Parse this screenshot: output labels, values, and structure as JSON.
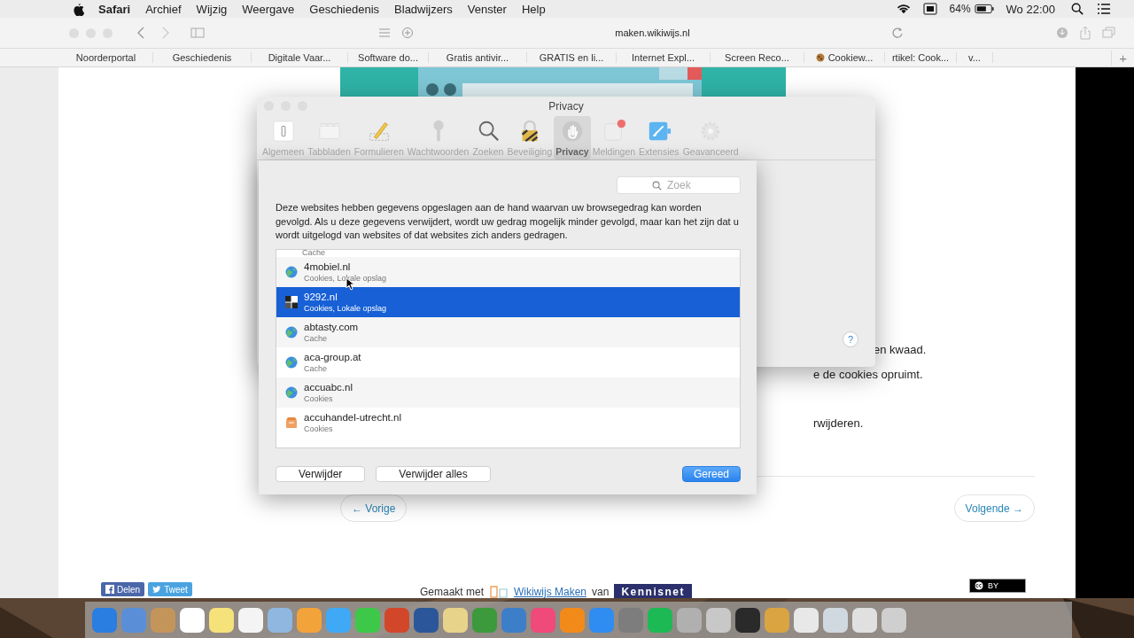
{
  "menu_bar": {
    "app": "Safari",
    "menus": [
      "Archief",
      "Wijzig",
      "Weergave",
      "Geschiedenis",
      "Bladwijzers",
      "Venster",
      "Help"
    ],
    "battery": "64%",
    "clock": "Wo 22:00"
  },
  "browser": {
    "url": "maken.wikiwijs.nl",
    "bookmarks": [
      "Noorderportal",
      "Geschiedenis",
      "Digitale Vaar...",
      "Software do...",
      "Gratis antivir...",
      "GRATIS en li...",
      "Internet Expl...",
      "Screen Reco...",
      "Cookiew...",
      "rtikel: Cook...",
      "v..."
    ],
    "new_tab": "+"
  },
  "page": {
    "texts": [
      "en kwaad.",
      "e de cookies opruimt.",
      "rwijderen."
    ],
    "previous": "← Vorige",
    "next": "Volgende →",
    "share": [
      "Delen",
      "Tweet"
    ],
    "footer": {
      "made_with": "Gemaakt met",
      "link": "Wikiwijs Maken",
      "by": "van",
      "brand": "Kennisnet",
      "license": "BY"
    }
  },
  "prefs_window": {
    "title": "Privacy",
    "tabs": [
      {
        "label": "Algemeen",
        "selected": false
      },
      {
        "label": "Tabbladen",
        "selected": false
      },
      {
        "label": "Formulieren",
        "selected": false
      },
      {
        "label": "Wachtwoorden",
        "selected": false
      },
      {
        "label": "Zoeken",
        "selected": false
      },
      {
        "label": "Beveiliging",
        "selected": false
      },
      {
        "label": "Privacy",
        "selected": true
      },
      {
        "label": "Meldingen",
        "selected": false
      },
      {
        "label": "Extensies",
        "selected": false
      },
      {
        "label": "Geavanceerd",
        "selected": false
      }
    ],
    "help": "?"
  },
  "sheet": {
    "search": {
      "placeholder": "Zoek"
    },
    "description": "Deze websites hebben gegevens opgeslagen aan de hand waarvan uw browsegedrag kan worden gevolgd. Als u deze gegevens verwijdert, wordt uw gedrag mogelijk minder gevolgd, maar kan het zijn dat u wordt uitgelogd van websites of dat websites zich anders gedragen.",
    "sites": [
      {
        "kind": "partial",
        "detail": "Cache",
        "selected": false
      },
      {
        "kind": "globe",
        "name": "4mobiel.nl",
        "detail": "Cookies, Lokale opslag",
        "selected": false
      },
      {
        "kind": "grid",
        "name": "9292.nl",
        "detail": "Cookies, Lokale opslag",
        "selected": true
      },
      {
        "kind": "globe",
        "name": "abtasty.com",
        "detail": "Cache",
        "selected": false
      },
      {
        "kind": "globe",
        "name": "aca-group.at",
        "detail": "Cache",
        "selected": false
      },
      {
        "kind": "globe",
        "name": "accuabc.nl",
        "detail": "Cookies",
        "selected": false
      },
      {
        "kind": "box",
        "name": "accuhandel-utrecht.nl",
        "detail": "Cookies",
        "selected": false
      }
    ],
    "buttons": [
      {
        "label": "Verwijder",
        "kind": "plain"
      },
      {
        "label": "Verwijder alles",
        "kind": "plain"
      },
      {
        "label": "Gereed",
        "kind": "default"
      }
    ]
  }
}
